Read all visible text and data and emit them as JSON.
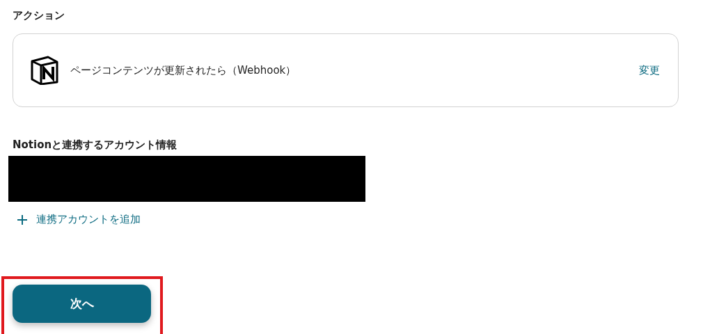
{
  "action_section": {
    "heading": "アクション",
    "trigger": {
      "label": "ページコンテンツが更新されたら（Webhook）",
      "change_link": "変更"
    }
  },
  "account_section": {
    "heading": "Notionと連携するアカウント情報",
    "redacted": true,
    "add_link": "連携アカウントを追加"
  },
  "next_button": {
    "label": "次へ",
    "highlighted": true
  }
}
